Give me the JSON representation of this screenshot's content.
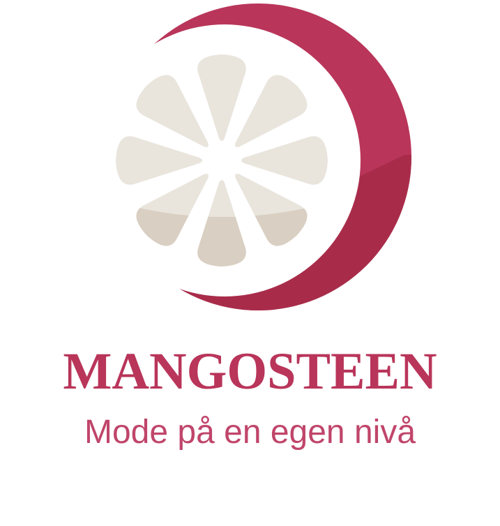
{
  "brand": {
    "name": "MANGOSTEEN",
    "tagline": "Mode på en egen nivå"
  },
  "logo": {
    "icon": "mangosteen-fruit-icon",
    "colors": {
      "crescent": "#b9355a",
      "crescent_shadow": "#a82c4a",
      "petal_light": "#e9e5dd",
      "petal_shade": "#d9cfc2"
    }
  }
}
